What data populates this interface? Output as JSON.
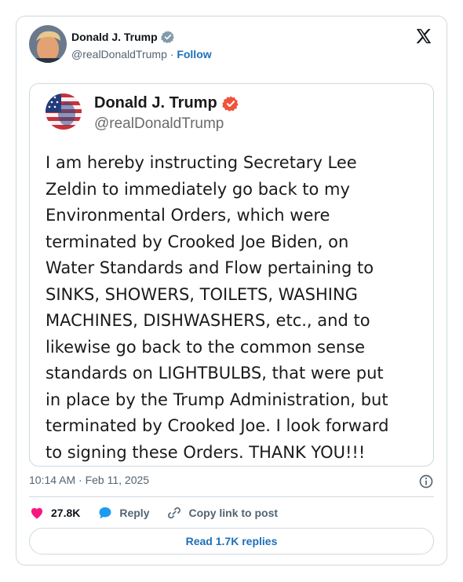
{
  "author": {
    "name": "Donald J. Trump",
    "handle": "@realDonaldTrump",
    "separator": "·",
    "follow_label": "Follow",
    "verified_color": "#829aab"
  },
  "embedded_post": {
    "name": "Donald J. Trump",
    "handle": "@realDonaldTrump",
    "verified_color": "#f0533b",
    "lines": [
      "I am hereby instructing Secretary Lee",
      "Zeldin to immediately go back to my",
      "Environmental Orders, which were",
      "terminated by Crooked Joe Biden, on",
      "Water Standards and Flow pertaining to",
      "SINKS, SHOWERS, TOILETS, WASHING",
      "MACHINES, DISHWASHERS, etc., and to",
      "likewise go back to the common sense",
      "standards on LIGHTBULBS, that were put",
      "in place by the Trump Administration, but",
      "terminated by Crooked Joe. I look forward",
      "to signing these Orders. THANK YOU!!!"
    ]
  },
  "meta": {
    "timestamp": "10:14 AM · Feb 11, 2025"
  },
  "actions": {
    "likes": "27.8K",
    "reply_label": "Reply",
    "copy_label": "Copy link to post"
  },
  "read_replies_label": "Read 1.7K replies",
  "icons": {
    "x_logo": "x-logo-icon",
    "verified": "verified-badge-icon",
    "info": "info-icon",
    "heart": "heart-icon",
    "reply": "reply-bubble-icon",
    "link": "link-icon"
  },
  "colors": {
    "heart": "#f91880",
    "reply": "#1d9bf0",
    "link_text": "#1d6fba",
    "border": "#cfd9de",
    "muted": "#536471"
  }
}
